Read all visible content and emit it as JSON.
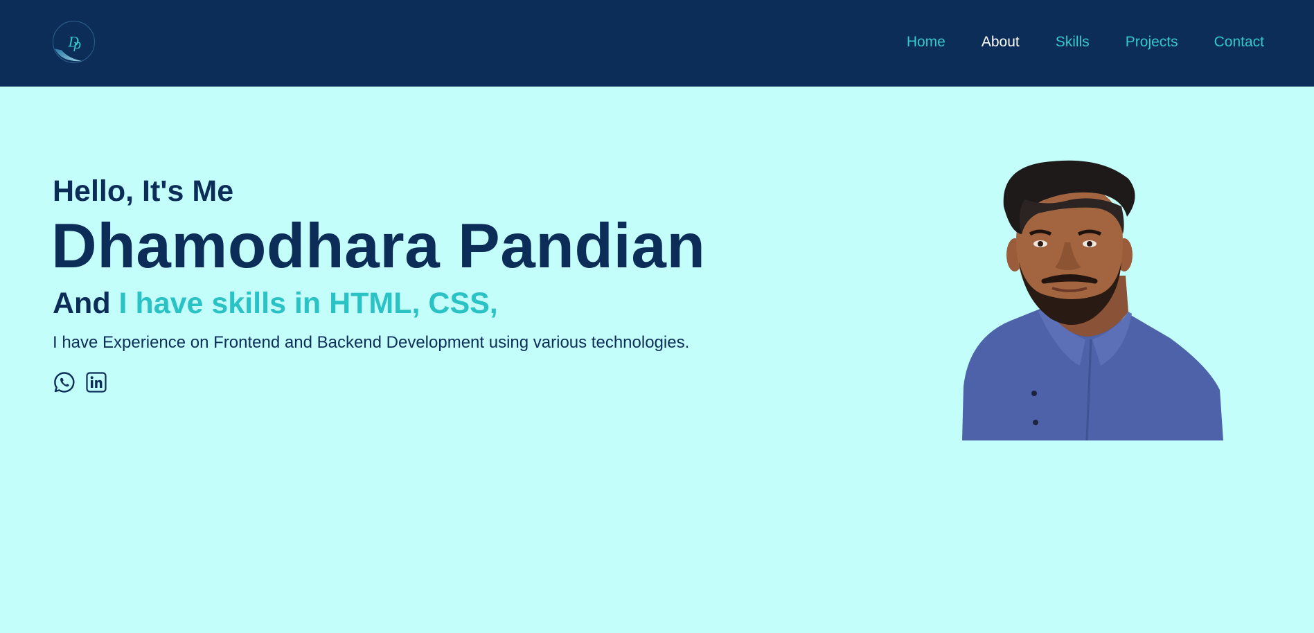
{
  "header": {
    "logo_alt": "DP",
    "nav": [
      {
        "label": "Home",
        "active": false
      },
      {
        "label": "About",
        "active": true
      },
      {
        "label": "Skills",
        "active": false
      },
      {
        "label": "Projects",
        "active": false
      },
      {
        "label": "Contact",
        "active": false
      }
    ]
  },
  "hero": {
    "greeting": "Hello, It's Me",
    "name": "Dhamodhara Pandian",
    "skills_prefix": "And ",
    "skills_typed": "I have skills in HTML, CSS,",
    "description": "I have Experience on Frontend and Backend Development using various technologies.",
    "socials": [
      {
        "icon": "whatsapp-icon"
      },
      {
        "icon": "linkedin-icon"
      }
    ]
  },
  "colors": {
    "navbar_bg": "#0b2d58",
    "page_bg": "#c3fefb",
    "primary_text": "#0b2d58",
    "accent": "#2bc2c5",
    "nav_active": "#ffffff"
  }
}
